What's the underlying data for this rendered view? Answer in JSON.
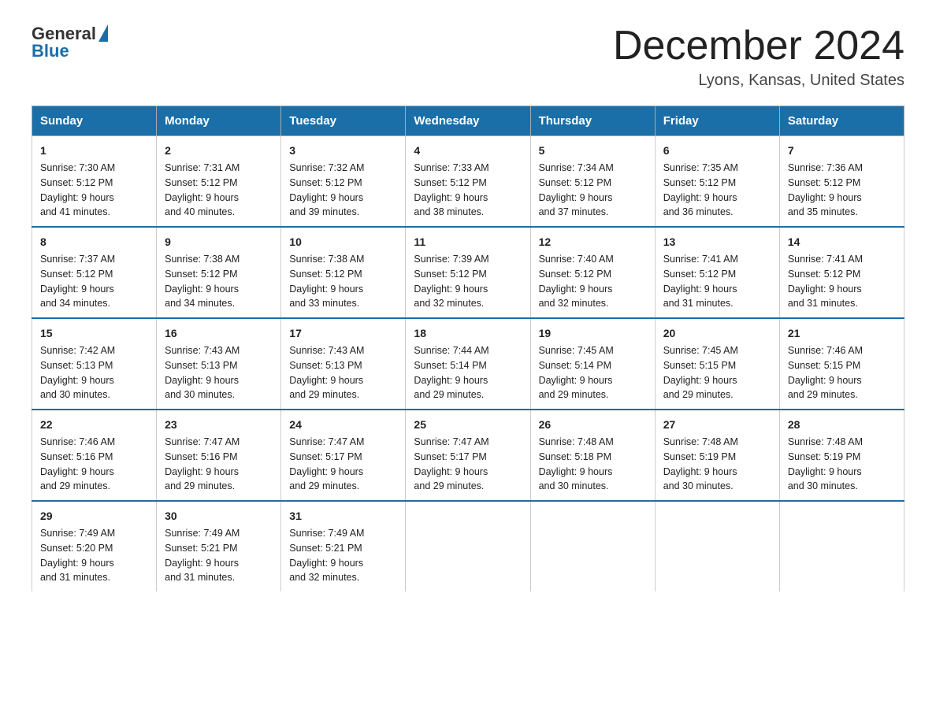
{
  "logo": {
    "general": "General",
    "blue": "Blue"
  },
  "title": "December 2024",
  "location": "Lyons, Kansas, United States",
  "days_header": [
    "Sunday",
    "Monday",
    "Tuesday",
    "Wednesday",
    "Thursday",
    "Friday",
    "Saturday"
  ],
  "weeks": [
    [
      {
        "day": "1",
        "sunrise": "7:30 AM",
        "sunset": "5:12 PM",
        "daylight": "9 hours and 41 minutes."
      },
      {
        "day": "2",
        "sunrise": "7:31 AM",
        "sunset": "5:12 PM",
        "daylight": "9 hours and 40 minutes."
      },
      {
        "day": "3",
        "sunrise": "7:32 AM",
        "sunset": "5:12 PM",
        "daylight": "9 hours and 39 minutes."
      },
      {
        "day": "4",
        "sunrise": "7:33 AM",
        "sunset": "5:12 PM",
        "daylight": "9 hours and 38 minutes."
      },
      {
        "day": "5",
        "sunrise": "7:34 AM",
        "sunset": "5:12 PM",
        "daylight": "9 hours and 37 minutes."
      },
      {
        "day": "6",
        "sunrise": "7:35 AM",
        "sunset": "5:12 PM",
        "daylight": "9 hours and 36 minutes."
      },
      {
        "day": "7",
        "sunrise": "7:36 AM",
        "sunset": "5:12 PM",
        "daylight": "9 hours and 35 minutes."
      }
    ],
    [
      {
        "day": "8",
        "sunrise": "7:37 AM",
        "sunset": "5:12 PM",
        "daylight": "9 hours and 34 minutes."
      },
      {
        "day": "9",
        "sunrise": "7:38 AM",
        "sunset": "5:12 PM",
        "daylight": "9 hours and 34 minutes."
      },
      {
        "day": "10",
        "sunrise": "7:38 AM",
        "sunset": "5:12 PM",
        "daylight": "9 hours and 33 minutes."
      },
      {
        "day": "11",
        "sunrise": "7:39 AM",
        "sunset": "5:12 PM",
        "daylight": "9 hours and 32 minutes."
      },
      {
        "day": "12",
        "sunrise": "7:40 AM",
        "sunset": "5:12 PM",
        "daylight": "9 hours and 32 minutes."
      },
      {
        "day": "13",
        "sunrise": "7:41 AM",
        "sunset": "5:12 PM",
        "daylight": "9 hours and 31 minutes."
      },
      {
        "day": "14",
        "sunrise": "7:41 AM",
        "sunset": "5:12 PM",
        "daylight": "9 hours and 31 minutes."
      }
    ],
    [
      {
        "day": "15",
        "sunrise": "7:42 AM",
        "sunset": "5:13 PM",
        "daylight": "9 hours and 30 minutes."
      },
      {
        "day": "16",
        "sunrise": "7:43 AM",
        "sunset": "5:13 PM",
        "daylight": "9 hours and 30 minutes."
      },
      {
        "day": "17",
        "sunrise": "7:43 AM",
        "sunset": "5:13 PM",
        "daylight": "9 hours and 29 minutes."
      },
      {
        "day": "18",
        "sunrise": "7:44 AM",
        "sunset": "5:14 PM",
        "daylight": "9 hours and 29 minutes."
      },
      {
        "day": "19",
        "sunrise": "7:45 AM",
        "sunset": "5:14 PM",
        "daylight": "9 hours and 29 minutes."
      },
      {
        "day": "20",
        "sunrise": "7:45 AM",
        "sunset": "5:15 PM",
        "daylight": "9 hours and 29 minutes."
      },
      {
        "day": "21",
        "sunrise": "7:46 AM",
        "sunset": "5:15 PM",
        "daylight": "9 hours and 29 minutes."
      }
    ],
    [
      {
        "day": "22",
        "sunrise": "7:46 AM",
        "sunset": "5:16 PM",
        "daylight": "9 hours and 29 minutes."
      },
      {
        "day": "23",
        "sunrise": "7:47 AM",
        "sunset": "5:16 PM",
        "daylight": "9 hours and 29 minutes."
      },
      {
        "day": "24",
        "sunrise": "7:47 AM",
        "sunset": "5:17 PM",
        "daylight": "9 hours and 29 minutes."
      },
      {
        "day": "25",
        "sunrise": "7:47 AM",
        "sunset": "5:17 PM",
        "daylight": "9 hours and 29 minutes."
      },
      {
        "day": "26",
        "sunrise": "7:48 AM",
        "sunset": "5:18 PM",
        "daylight": "9 hours and 30 minutes."
      },
      {
        "day": "27",
        "sunrise": "7:48 AM",
        "sunset": "5:19 PM",
        "daylight": "9 hours and 30 minutes."
      },
      {
        "day": "28",
        "sunrise": "7:48 AM",
        "sunset": "5:19 PM",
        "daylight": "9 hours and 30 minutes."
      }
    ],
    [
      {
        "day": "29",
        "sunrise": "7:49 AM",
        "sunset": "5:20 PM",
        "daylight": "9 hours and 31 minutes."
      },
      {
        "day": "30",
        "sunrise": "7:49 AM",
        "sunset": "5:21 PM",
        "daylight": "9 hours and 31 minutes."
      },
      {
        "day": "31",
        "sunrise": "7:49 AM",
        "sunset": "5:21 PM",
        "daylight": "9 hours and 32 minutes."
      },
      null,
      null,
      null,
      null
    ]
  ],
  "labels": {
    "sunrise": "Sunrise:",
    "sunset": "Sunset:",
    "daylight": "Daylight:"
  },
  "colors": {
    "header_bg": "#1a6fa8",
    "header_text": "#ffffff",
    "border": "#1a6fa8"
  }
}
